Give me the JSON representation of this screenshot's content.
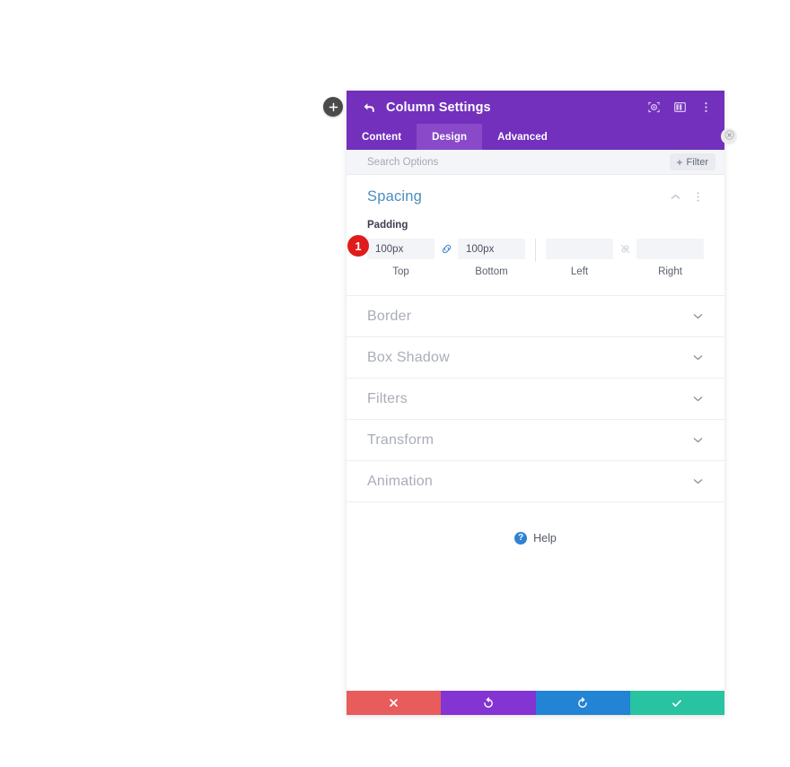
{
  "overlay": {
    "add_button_label": "+",
    "add_button_icon": "plus-icon",
    "close_button_icon": "close-circle-icon"
  },
  "header": {
    "title": "Column Settings",
    "back_icon": "back-arrow-icon",
    "icons": [
      {
        "name": "focus-target-icon",
        "label": ""
      },
      {
        "name": "layout-columns-icon",
        "label": ""
      },
      {
        "name": "more-vertical-icon",
        "label": ""
      }
    ]
  },
  "tabs": [
    {
      "label": "Content",
      "active": false
    },
    {
      "label": "Design",
      "active": true
    },
    {
      "label": "Advanced",
      "active": false
    }
  ],
  "search": {
    "placeholder": "Search Options",
    "value": "",
    "filter_label": "Filter",
    "filter_plus": "+"
  },
  "spacing": {
    "title": "Spacing",
    "collapse_icon": "chevron-up-icon",
    "menu_icon": "more-vertical-icon",
    "padding_label": "Padding",
    "step_badge": "1",
    "fields": [
      {
        "key": "top",
        "sub_label": "Top",
        "value": "100px",
        "placeholder": ""
      },
      {
        "key": "bottom",
        "sub_label": "Bottom",
        "value": "100px",
        "placeholder": ""
      },
      {
        "key": "left",
        "sub_label": "Left",
        "value": "",
        "placeholder": ""
      },
      {
        "key": "right",
        "sub_label": "Right",
        "value": "",
        "placeholder": ""
      }
    ],
    "link_top_bottom": {
      "icon": "link-connected-icon",
      "state": "linked"
    },
    "link_left_right": {
      "icon": "link-broken-icon",
      "state": "unlinked"
    }
  },
  "sections": [
    {
      "label": "Border",
      "chevron": "chevron-down-icon"
    },
    {
      "label": "Box Shadow",
      "chevron": "chevron-down-icon"
    },
    {
      "label": "Filters",
      "chevron": "chevron-down-icon"
    },
    {
      "label": "Transform",
      "chevron": "chevron-down-icon"
    },
    {
      "label": "Animation",
      "chevron": "chevron-down-icon"
    }
  ],
  "help": {
    "label": "Help",
    "icon": "question-circle-icon"
  },
  "footer": {
    "buttons": [
      {
        "name": "cancel-button",
        "icon": "close-x-icon",
        "label": ""
      },
      {
        "name": "undo-button",
        "icon": "undo-icon",
        "label": ""
      },
      {
        "name": "redo-button",
        "icon": "redo-icon",
        "label": ""
      },
      {
        "name": "save-button",
        "icon": "checkmark-icon",
        "label": ""
      }
    ]
  },
  "colors": {
    "header_purple": "#7230bd",
    "tab_active_purple": "#8949c9",
    "accent_blue": "#4a8fbd",
    "badge_red": "#e01b1b",
    "cancel_red": "#e85c5c",
    "undo_purple": "#8334d2",
    "redo_blue": "#2383d4",
    "save_teal": "#28c3a1"
  }
}
